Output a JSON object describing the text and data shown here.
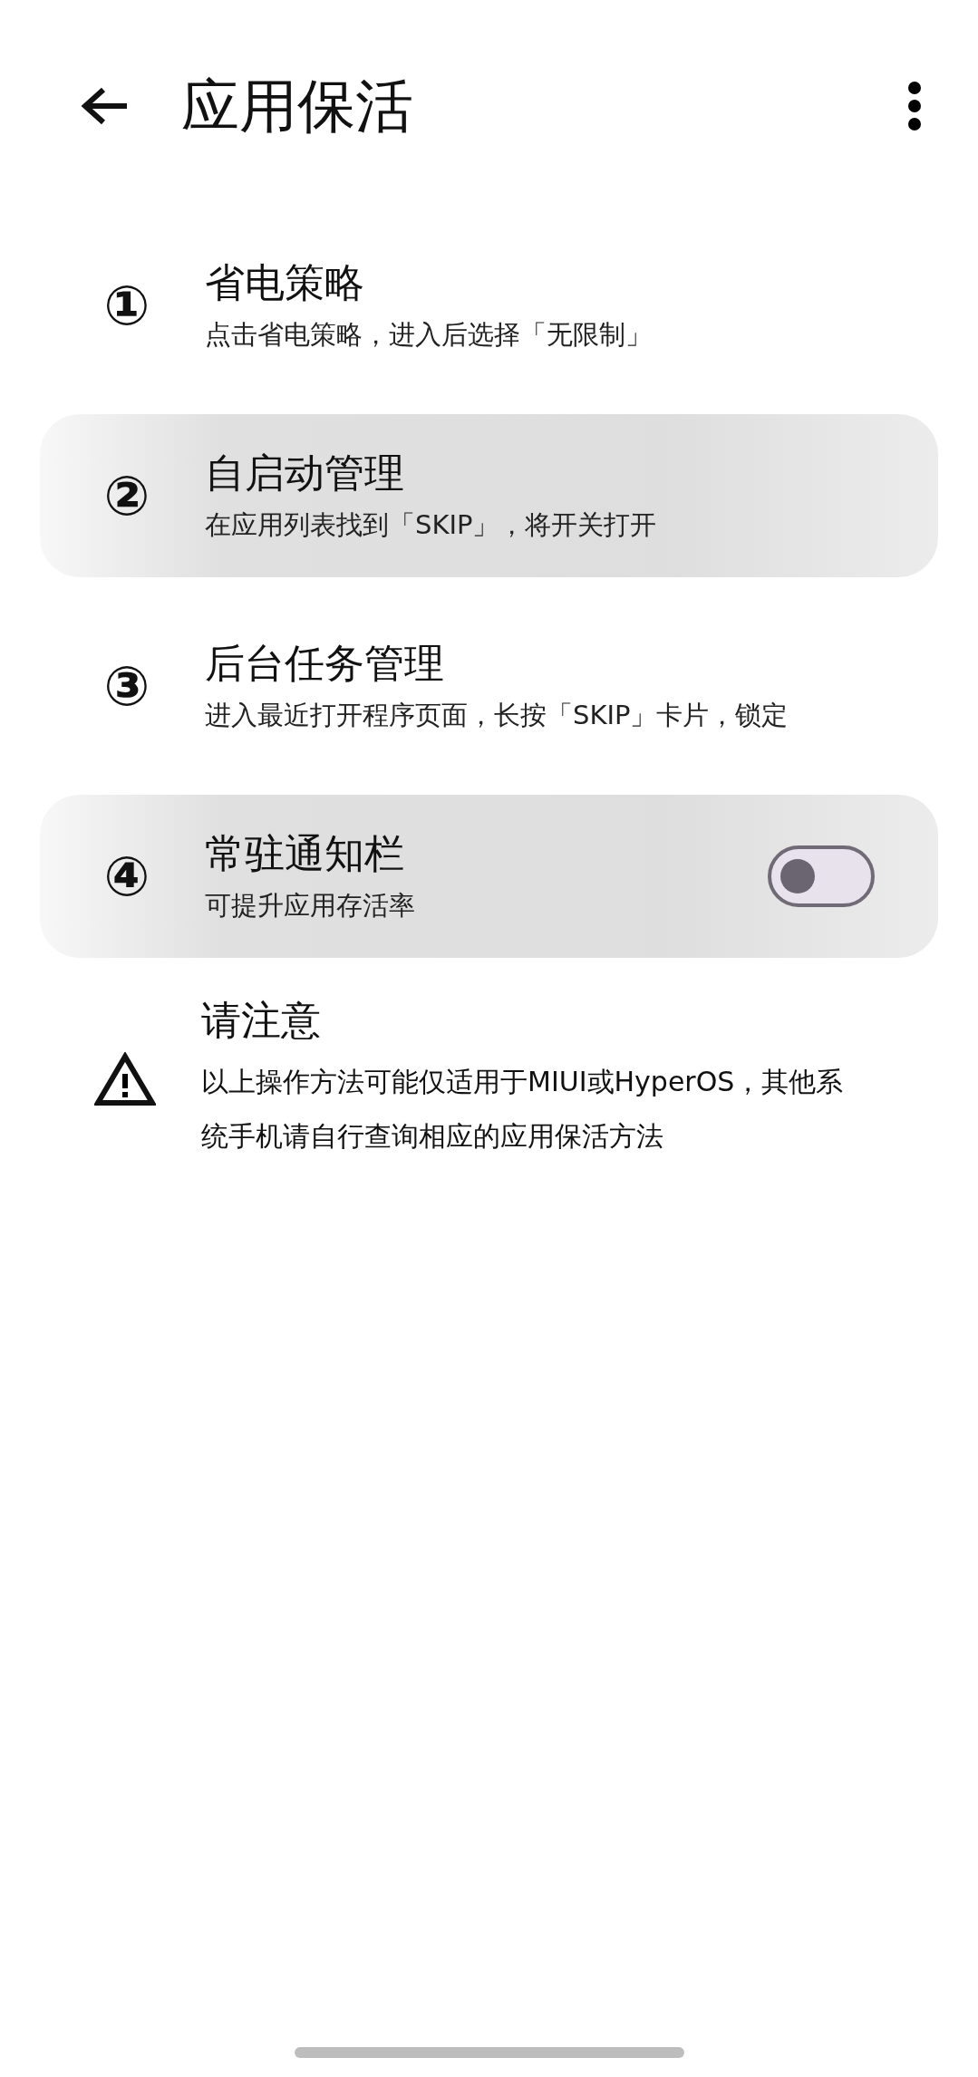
{
  "app_bar": {
    "title": "应用保活"
  },
  "steps": [
    {
      "kind": "plain",
      "number": "①",
      "title": "省电策略",
      "subtitle": "点击省电策略，进入后选择「无限制」",
      "pressed": false
    },
    {
      "kind": "plain",
      "number": "②",
      "title": "自启动管理",
      "subtitle": "在应用列表找到「SKIP」，将开关打开",
      "pressed": true
    },
    {
      "kind": "plain",
      "number": "③",
      "title": "后台任务管理",
      "subtitle": "进入最近打开程序页面，长按「SKIP」卡片，锁定",
      "pressed": false
    },
    {
      "kind": "switch",
      "number": "④",
      "title": "常驻通知栏",
      "subtitle": "可提升应用存活率",
      "pressed": true,
      "on": false
    }
  ],
  "notice": {
    "title": "请注意",
    "text": "以上操作方法可能仅适用于MIUI或HyperOS，其他系统手机请自行查询相应的应用保活方法"
  }
}
